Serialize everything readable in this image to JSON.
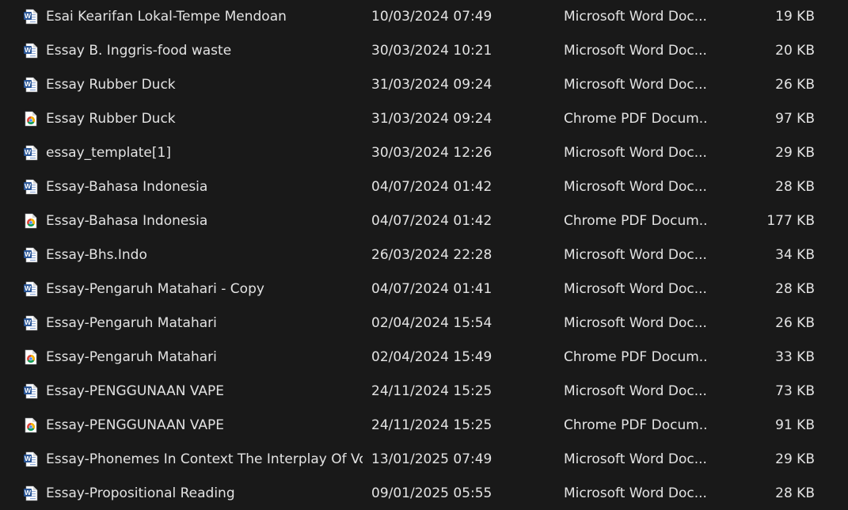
{
  "file_list": {
    "rows": [
      {
        "icon": "word-document-icon",
        "name": "Esai Kearifan Lokal-Tempe Mendoan",
        "date_modified": "10/03/2024 07:49",
        "type": "Microsoft Word Doc...",
        "size": "19 KB"
      },
      {
        "icon": "word-document-icon",
        "name": "Essay B. Inggris-food waste",
        "date_modified": "30/03/2024 10:21",
        "type": "Microsoft Word Doc...",
        "size": "20 KB"
      },
      {
        "icon": "word-document-icon",
        "name": "Essay Rubber Duck",
        "date_modified": "31/03/2024 09:24",
        "type": "Microsoft Word Doc...",
        "size": "26 KB"
      },
      {
        "icon": "chrome-pdf-icon",
        "name": "Essay Rubber Duck",
        "date_modified": "31/03/2024 09:24",
        "type": "Chrome PDF Docum...",
        "size": "97 KB"
      },
      {
        "icon": "word-document-icon",
        "name": "essay_template[1]",
        "date_modified": "30/03/2024 12:26",
        "type": "Microsoft Word Doc...",
        "size": "29 KB"
      },
      {
        "icon": "word-document-icon",
        "name": "Essay-Bahasa Indonesia",
        "date_modified": "04/07/2024 01:42",
        "type": "Microsoft Word Doc...",
        "size": "28 KB"
      },
      {
        "icon": "chrome-pdf-icon",
        "name": "Essay-Bahasa Indonesia",
        "date_modified": "04/07/2024 01:42",
        "type": "Chrome PDF Docum...",
        "size": "177 KB"
      },
      {
        "icon": "word-document-icon",
        "name": "Essay-Bhs.Indo",
        "date_modified": "26/03/2024 22:28",
        "type": "Microsoft Word Doc...",
        "size": "34 KB"
      },
      {
        "icon": "word-document-icon",
        "name": "Essay-Pengaruh Matahari - Copy",
        "date_modified": "04/07/2024 01:41",
        "type": "Microsoft Word Doc...",
        "size": "28 KB"
      },
      {
        "icon": "word-document-icon",
        "name": "Essay-Pengaruh Matahari",
        "date_modified": "02/04/2024 15:54",
        "type": "Microsoft Word Doc...",
        "size": "26 KB"
      },
      {
        "icon": "chrome-pdf-icon",
        "name": "Essay-Pengaruh Matahari",
        "date_modified": "02/04/2024 15:49",
        "type": "Chrome PDF Docum...",
        "size": "33 KB"
      },
      {
        "icon": "word-document-icon",
        "name": "Essay-PENGGUNAAN VAPE",
        "date_modified": "24/11/2024 15:25",
        "type": "Microsoft Word Doc...",
        "size": "73 KB"
      },
      {
        "icon": "chrome-pdf-icon",
        "name": "Essay-PENGGUNAAN VAPE",
        "date_modified": "24/11/2024 15:25",
        "type": "Chrome PDF Docum...",
        "size": "91 KB"
      },
      {
        "icon": "word-document-icon",
        "name": "Essay-Phonemes In Context The Interplay Of Vo...",
        "date_modified": "13/01/2025 07:49",
        "type": "Microsoft Word Doc...",
        "size": "29 KB"
      },
      {
        "icon": "word-document-icon",
        "name": "Essay-Propositional Reading",
        "date_modified": "09/01/2025 05:55",
        "type": "Microsoft Word Doc...",
        "size": "28 KB"
      }
    ]
  },
  "colors": {
    "background": "#191919",
    "text": "#e3e3e3",
    "word_blue": "#2b5797",
    "chrome_red": "#db4437",
    "chrome_yellow": "#f4b400",
    "chrome_green": "#0f9d58",
    "chrome_blue": "#4285f4"
  }
}
